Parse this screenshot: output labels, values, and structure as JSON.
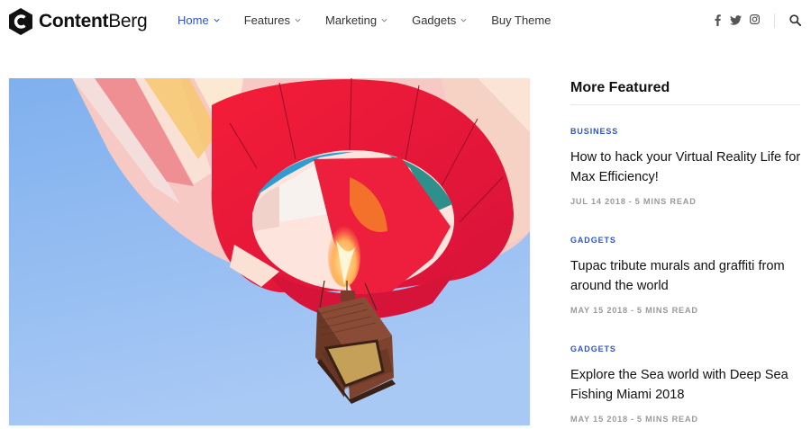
{
  "brand": {
    "name_bold": "Content",
    "name_light": "Berg",
    "accent": "#2f54c9"
  },
  "nav": {
    "items": [
      {
        "label": "Home",
        "active": true,
        "has_dropdown": true
      },
      {
        "label": "Features",
        "active": false,
        "has_dropdown": true
      },
      {
        "label": "Marketing",
        "active": false,
        "has_dropdown": true
      },
      {
        "label": "Gadgets",
        "active": false,
        "has_dropdown": true
      },
      {
        "label": "Buy Theme",
        "active": false,
        "has_dropdown": false
      }
    ]
  },
  "header_icons": [
    "facebook-icon",
    "twitter-icon",
    "instagram-icon",
    "search-icon"
  ],
  "hero": {
    "image": "hot-air-balloon"
  },
  "sidebar": {
    "title": "More Featured",
    "posts": [
      {
        "category": "Business",
        "title": "How to hack your Virtual Reality Life for Max Efficiency!",
        "date": "Jul 14 2018",
        "read_time": "5 Mins Read"
      },
      {
        "category": "Gadgets",
        "title": "Tupac tribute murals and graffiti from around the world",
        "date": "May 15 2018",
        "read_time": "5 Mins Read"
      },
      {
        "category": "Gadgets",
        "title": "Explore the Sea world with Deep Sea Fishing Miami 2018",
        "date": "May 15 2018",
        "read_time": "5 Mins Read"
      }
    ],
    "meta_separator": "-"
  }
}
